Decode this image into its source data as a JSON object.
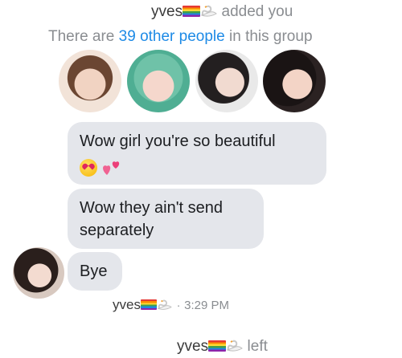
{
  "system": {
    "added": {
      "name": "yves",
      "suffix": "added you"
    },
    "group_info": {
      "prefix": "There are ",
      "link": "39 other people",
      "suffix": " in this group"
    },
    "left": {
      "name": "yves",
      "suffix": "left"
    }
  },
  "group_members": [
    {
      "name": "member-1"
    },
    {
      "name": "member-2"
    },
    {
      "name": "member-3"
    },
    {
      "name": "member-4"
    }
  ],
  "messages": [
    {
      "line1": "Wow girl you're so beautiful",
      "emoji": "smiling-face-with-heart-eyes, two-hearts"
    },
    {
      "line1": "Wow they ain't send",
      "line2": "separately"
    },
    {
      "line1": "Bye"
    }
  ],
  "sender": {
    "name": "yves",
    "time": "3:29 PM"
  },
  "colors": {
    "bubble": "#e4e6eb",
    "link": "#1d8ae6",
    "meta": "#8a8d91"
  }
}
